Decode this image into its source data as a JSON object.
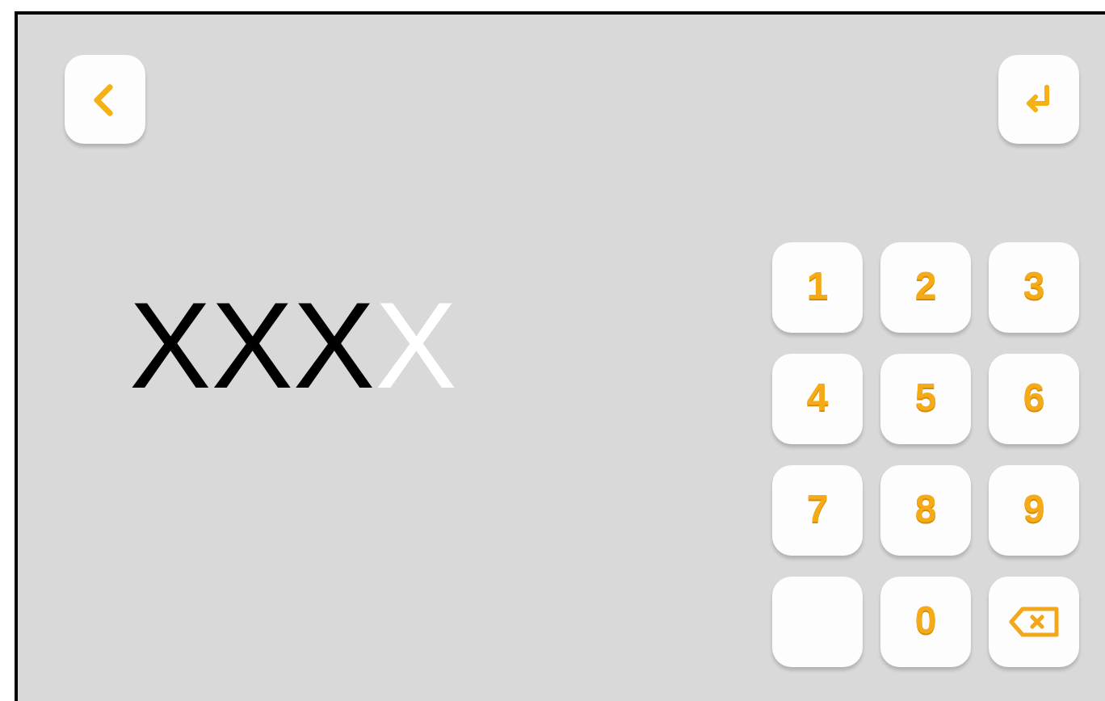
{
  "pin": [
    {
      "char": "X",
      "filled": true
    },
    {
      "char": "X",
      "filled": true
    },
    {
      "char": "X",
      "filled": true
    },
    {
      "char": "X",
      "filled": false
    }
  ],
  "keypad": [
    {
      "kind": "digit",
      "label": "1"
    },
    {
      "kind": "digit",
      "label": "2"
    },
    {
      "kind": "digit",
      "label": "3"
    },
    {
      "kind": "digit",
      "label": "4"
    },
    {
      "kind": "digit",
      "label": "5"
    },
    {
      "kind": "digit",
      "label": "6"
    },
    {
      "kind": "digit",
      "label": "7"
    },
    {
      "kind": "digit",
      "label": "8"
    },
    {
      "kind": "digit",
      "label": "9"
    },
    {
      "kind": "blank"
    },
    {
      "kind": "digit",
      "label": "0"
    },
    {
      "kind": "backspace"
    }
  ]
}
